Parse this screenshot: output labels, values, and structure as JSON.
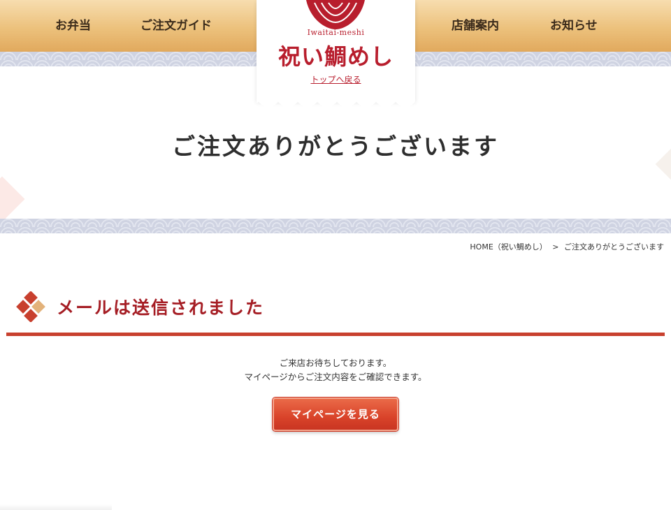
{
  "nav": {
    "bento": "お弁当",
    "guide": "ご注文ガイド",
    "store": "店舗案内",
    "news": "お知らせ"
  },
  "logo": {
    "sub": "Iwaitai-meshi",
    "main": "祝い鯛めし",
    "back_link": "トップへ戻る",
    "color": "#b81e2d"
  },
  "page": {
    "title": "ご注文ありがとうございます"
  },
  "breadcrumb": {
    "home": "HOME（祝い鯛めし）",
    "separator": ">",
    "current": "ご注文ありがとうございます"
  },
  "section": {
    "title": "メールは送信されました",
    "accent_color": "#c8402e"
  },
  "message": {
    "line1": "ご来店お待ちしております。",
    "line2": "マイページからご注文内容をご確認できます。"
  },
  "button": {
    "label": "マイページを見る"
  },
  "icons": {
    "logo_emblem": "fish-crest-icon",
    "section_marker": "diamond-cluster-icon"
  }
}
